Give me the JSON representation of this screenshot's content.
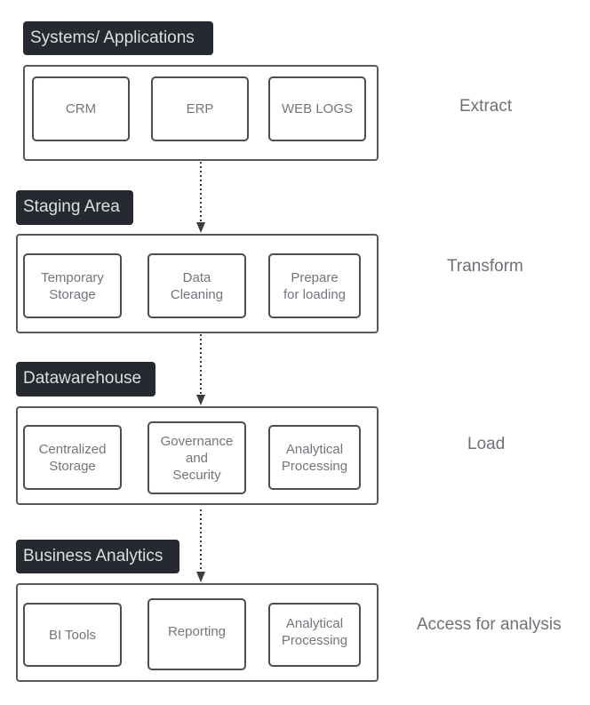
{
  "colors": {
    "header_bg": "#262a30",
    "header_text": "#dcdee1",
    "box_border": "#4a4e54",
    "box_text": "#72767c",
    "stage_text": "#6d7177"
  },
  "layers": [
    {
      "title": "Systems/ Applications",
      "stage": "Extract",
      "items": [
        "CRM",
        "ERP",
        "WEB LOGS"
      ]
    },
    {
      "title": "Staging Area",
      "stage": "Transform",
      "items": [
        "Temporary\nStorage",
        "Data\nCleaning",
        "Prepare\nfor loading"
      ]
    },
    {
      "title": "Datawarehouse",
      "stage": "Load",
      "items": [
        "Centralized\nStorage",
        "Governance\nand\nSecurity",
        "Analytical\nProcessing"
      ]
    },
    {
      "title": "Business Analytics",
      "stage": "Access for analysis",
      "items": [
        "BI Tools",
        "Reporting",
        "Analytical\nProcessing"
      ]
    }
  ]
}
